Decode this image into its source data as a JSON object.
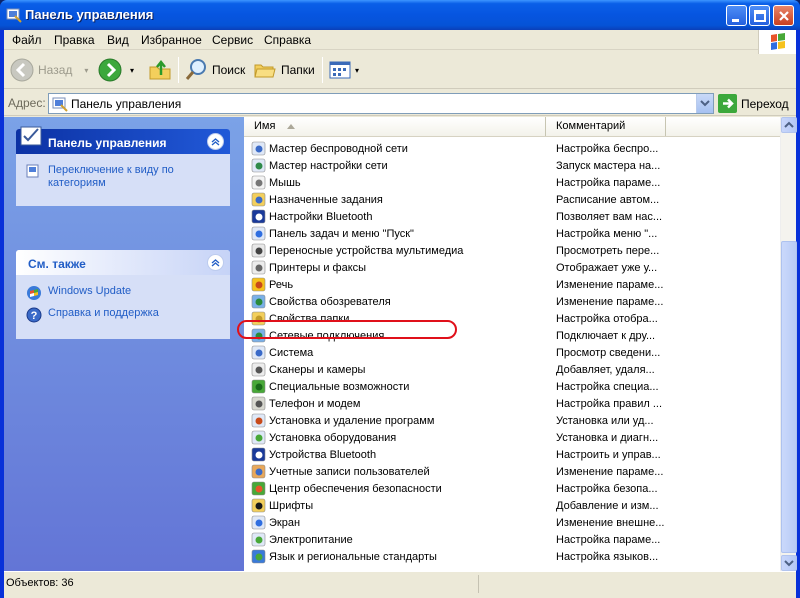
{
  "window": {
    "title": "Панель управления"
  },
  "menu": [
    "Файл",
    "Правка",
    "Вид",
    "Избранное",
    "Сервис",
    "Справка"
  ],
  "toolbar": {
    "back_label": "Назад",
    "search_label": "Поиск",
    "folders_label": "Папки"
  },
  "address": {
    "label": "Адрес:",
    "value": "Панель управления",
    "go_label": "Переход"
  },
  "taskpane": {
    "control_panel": {
      "title": "Панель управления",
      "link": "Переключение к виду по категориям"
    },
    "see_also": {
      "title": "См. также",
      "links": [
        "Windows Update",
        "Справка и поддержка"
      ]
    }
  },
  "list": {
    "columns": [
      "Имя",
      "Комментарий"
    ],
    "rows": [
      {
        "name": "Мастер беспроводной сети",
        "comment": "Настройка беспро...",
        "icon": "wireless-wizard-icon"
      },
      {
        "name": "Мастер настройки сети",
        "comment": "Запуск мастера на...",
        "icon": "network-wizard-icon"
      },
      {
        "name": "Мышь",
        "comment": "Настройка параме...",
        "icon": "mouse-icon"
      },
      {
        "name": "Назначенные задания",
        "comment": "Расписание автом...",
        "icon": "scheduled-tasks-icon"
      },
      {
        "name": "Настройки Bluetooth",
        "comment": "Позволяет вам нас...",
        "icon": "bluetooth-icon"
      },
      {
        "name": "Панель задач и меню \"Пуск\"",
        "comment": "Настройка меню \"...",
        "icon": "taskbar-icon"
      },
      {
        "name": "Переносные устройства мультимедиа",
        "comment": "Просмотреть пере...",
        "icon": "portable-media-icon"
      },
      {
        "name": "Принтеры и факсы",
        "comment": "Отображает уже у...",
        "icon": "printer-icon"
      },
      {
        "name": "Речь",
        "comment": "Изменение параме...",
        "icon": "speech-icon"
      },
      {
        "name": "Свойства обозревателя",
        "comment": "Изменение параме...",
        "icon": "internet-options-icon"
      },
      {
        "name": "Свойства папки",
        "comment": "Настройка отобра...",
        "icon": "folder-options-icon"
      },
      {
        "name": "Сетевые подключения",
        "comment": "Подключает к дру...",
        "icon": "network-connections-icon"
      },
      {
        "name": "Система",
        "comment": "Просмотр сведени...",
        "icon": "system-icon"
      },
      {
        "name": "Сканеры и камеры",
        "comment": "Добавляет, удаля...",
        "icon": "scanner-icon"
      },
      {
        "name": "Специальные возможности",
        "comment": "Настройка специа...",
        "icon": "accessibility-icon"
      },
      {
        "name": "Телефон и модем",
        "comment": "Настройка правил ...",
        "icon": "phone-modem-icon"
      },
      {
        "name": "Установка и удаление программ",
        "comment": "Установка или уд...",
        "icon": "add-remove-programs-icon"
      },
      {
        "name": "Установка оборудования",
        "comment": "Установка и диагн...",
        "icon": "add-hardware-icon"
      },
      {
        "name": "Устройства Bluetooth",
        "comment": "Настроить и управ...",
        "icon": "bluetooth-devices-icon"
      },
      {
        "name": "Учетные записи пользователей",
        "comment": "Изменение параме...",
        "icon": "user-accounts-icon"
      },
      {
        "name": "Центр обеспечения безопасности",
        "comment": "Настройка безопа...",
        "icon": "security-center-icon"
      },
      {
        "name": "Шрифты",
        "comment": "Добавление и изм...",
        "icon": "fonts-icon"
      },
      {
        "name": "Экран",
        "comment": "Изменение внешне...",
        "icon": "display-icon"
      },
      {
        "name": "Электропитание",
        "comment": "Настройка параме...",
        "icon": "power-options-icon"
      },
      {
        "name": "Язык и региональные стандарты",
        "comment": "Настройка языков...",
        "icon": "regional-settings-icon"
      }
    ],
    "highlighted_row": "Сетевые подключения"
  },
  "status": {
    "text": "Объектов: 36"
  }
}
